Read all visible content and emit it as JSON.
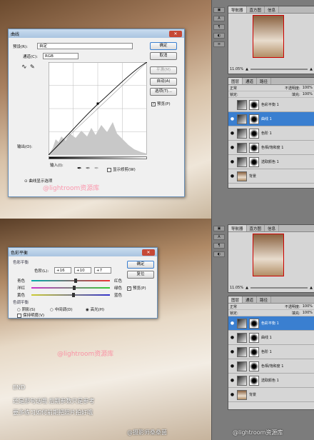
{
  "curves_dialog": {
    "title": "曲线",
    "preset_label": "预设(R):",
    "preset_value": "自定",
    "channel_label": "通道(C):",
    "channel_value": "RGB",
    "output_label": "输出(O):",
    "input_label": "输入(I):",
    "ok": "确定",
    "cancel": "取消",
    "smooth": "平滑(M)",
    "auto": "自动(A)",
    "options": "选项(T)...",
    "preview": "预览(P)",
    "show_clipping": "显示修剪(W)",
    "curve_display_options": "曲线显示选项"
  },
  "color_balance_dialog": {
    "title": "色彩平衡",
    "section_balance": "色彩平衡",
    "levels_label": "色阶(L):",
    "levels": [
      "+16",
      "+10",
      "+7"
    ],
    "sliders": [
      {
        "left": "青色",
        "right": "红色",
        "value": 16
      },
      {
        "left": "洋红",
        "right": "绿色",
        "value": 10
      },
      {
        "left": "黄色",
        "right": "蓝色",
        "value": 7
      }
    ],
    "section_tone": "色调平衡",
    "shadows": "阴影(S)",
    "midtones": "中间调(D)",
    "highlights": "高光(H)",
    "preserve_luminosity": "保持明度(V)",
    "ok": "确定",
    "reset": "复位",
    "preview": "预览(P)"
  },
  "right_panels": {
    "nav_tabs": [
      "导航器",
      "直方图",
      "信息"
    ],
    "zoom": "11.05%",
    "layer_tabs": [
      "图层",
      "通道",
      "路径"
    ],
    "blend_mode": "正常",
    "opacity_label": "不透明度:",
    "opacity": "100%",
    "lock_label": "锁定:",
    "fill_label": "填充:",
    "fill": "100%",
    "layers_top": [
      {
        "name": "色彩平衡 1",
        "visible": false,
        "selected": false
      },
      {
        "name": "曲线 1",
        "visible": true,
        "selected": true
      },
      {
        "name": "色阶 1",
        "visible": true,
        "selected": false
      },
      {
        "name": "色相/饱和度 1",
        "visible": true,
        "selected": false
      },
      {
        "name": "选取颜色 1",
        "visible": true,
        "selected": false
      },
      {
        "name": "背景",
        "visible": true,
        "selected": false
      }
    ],
    "layers_bottom": [
      {
        "name": "色彩平衡 1",
        "visible": true,
        "selected": true
      },
      {
        "name": "曲线 1",
        "visible": true,
        "selected": false
      },
      {
        "name": "色阶 1",
        "visible": true,
        "selected": false
      },
      {
        "name": "色相/饱和度 1",
        "visible": true,
        "selected": false
      },
      {
        "name": "选取颜色 1",
        "visible": true,
        "selected": false
      },
      {
        "name": "背景",
        "visible": true,
        "selected": false
      }
    ]
  },
  "overlay": {
    "watermark": "@lightroom资源库",
    "caption_end": "END",
    "caption_line1": "还是那句话哦 后期参数只是参考",
    "caption_line2": "要多练习如何前期把照片拍好哦",
    "footer_left": "@摄影师桑桑菌",
    "footer_right": "@lightroom资源库"
  },
  "colors": {
    "accent": "#3a7fd0",
    "dialog_close": "#c64836",
    "watermark": "#ff7896"
  }
}
